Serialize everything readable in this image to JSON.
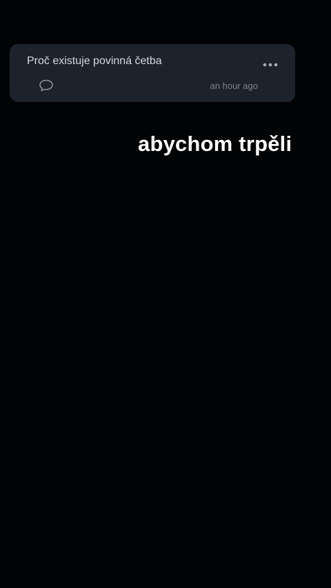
{
  "post": {
    "title": "Proč existuje povinná četba",
    "timestamp": "an hour ago",
    "icons": {
      "more": "more-horizontal-icon",
      "comments": "comment-bubble-icon"
    }
  },
  "caption": {
    "text": "abychom trpěli"
  },
  "colors": {
    "background": "#020304",
    "card_background": "#1d232c",
    "title_text": "#d6dae0",
    "muted_text": "#7c838d",
    "caption_text": "#ffffff"
  }
}
